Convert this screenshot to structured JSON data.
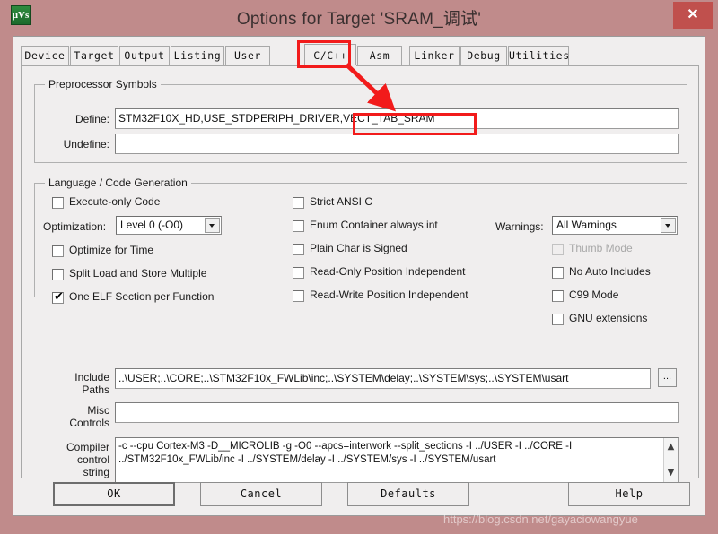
{
  "window": {
    "title": "Options for Target 'SRAM_调试'",
    "app_icon_label": "μVs",
    "close_label": "✕",
    "titlebar_color": "#c08b8b",
    "close_button_color": "#c0504d"
  },
  "tabs": [
    {
      "label": "Device",
      "active": false
    },
    {
      "label": "Target",
      "active": false
    },
    {
      "label": "Output",
      "active": false
    },
    {
      "label": "Listing",
      "active": false
    },
    {
      "label": "User",
      "active": false
    },
    {
      "label": "C/C++",
      "active": true
    },
    {
      "label": "Asm",
      "active": false
    },
    {
      "label": "Linker",
      "active": false
    },
    {
      "label": "Debug",
      "active": false
    },
    {
      "label": "Utilities",
      "active": false
    }
  ],
  "preprocessor": {
    "group_label": "Preprocessor Symbols",
    "define_label": "Define:",
    "define_value": "STM32F10X_HD,USE_STDPERIPH_DRIVER,VECT_TAB_SRAM",
    "undefine_label": "Undefine:",
    "undefine_value": ""
  },
  "language": {
    "group_label": "Language / Code Generation",
    "left_checks": [
      {
        "label": "Execute-only Code",
        "checked": false,
        "disabled": false
      },
      {
        "label": "Optimize for Time",
        "checked": false,
        "disabled": false
      },
      {
        "label": "Split Load and Store Multiple",
        "checked": false,
        "disabled": false
      },
      {
        "label": "One ELF Section per Function",
        "checked": true,
        "disabled": false
      }
    ],
    "optimization_label": "Optimization:",
    "optimization_value": "Level 0 (-O0)",
    "middle_checks": [
      {
        "label": "Strict ANSI C",
        "checked": false,
        "disabled": false
      },
      {
        "label": "Enum Container always int",
        "checked": false,
        "disabled": false
      },
      {
        "label": "Plain Char is Signed",
        "checked": false,
        "disabled": false
      },
      {
        "label": "Read-Only Position Independent",
        "checked": false,
        "disabled": false
      },
      {
        "label": "Read-Write Position Independent",
        "checked": false,
        "disabled": false
      }
    ],
    "warnings_label": "Warnings:",
    "warnings_value": "All Warnings",
    "right_checks": [
      {
        "label": "Thumb Mode",
        "checked": false,
        "disabled": true
      },
      {
        "label": "No Auto Includes",
        "checked": false,
        "disabled": false
      },
      {
        "label": "C99 Mode",
        "checked": false,
        "disabled": false
      },
      {
        "label": "GNU extensions",
        "checked": false,
        "disabled": false
      }
    ]
  },
  "paths": {
    "include_label_line1": "Include",
    "include_label_line2": "Paths",
    "include_value": "..\\USER;..\\CORE;..\\STM32F10x_FWLib\\inc;..\\SYSTEM\\delay;..\\SYSTEM\\sys;..\\SYSTEM\\usart",
    "browse_label": "...",
    "misc_label_line1": "Misc",
    "misc_label_line2": "Controls",
    "misc_value": "",
    "compiler_label_line1": "Compiler",
    "compiler_label_line2": "control",
    "compiler_label_line3": "string",
    "compiler_value_line1": "-c --cpu Cortex-M3 -D__MICROLIB -g -O0 --apcs=interwork --split_sections -I ../USER -I ../CORE -I",
    "compiler_value_line2": "../STM32F10x_FWLib/inc -I ../SYSTEM/delay -I ../SYSTEM/sys -I ../SYSTEM/usart",
    "scroll_up_glyph": "▲",
    "scroll_down_glyph": "▼"
  },
  "buttons": {
    "ok": "OK",
    "cancel": "Cancel",
    "defaults": "Defaults",
    "help": "Help"
  },
  "annotations": {
    "highlight_color": "#f21b1b",
    "tab_highlight": "C/C++",
    "define_highlight": ",VECT_TAB_SRAM",
    "arrow_from_tab_to_define": true
  },
  "watermark": "https://blog.csdn.net/gayaciowangyue"
}
